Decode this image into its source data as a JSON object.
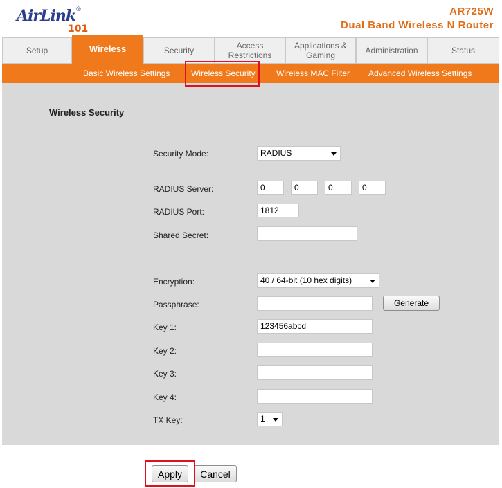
{
  "brand": {
    "logo_text": "AirLink",
    "logo_reg": "®",
    "logo_101": "101",
    "model": "AR725W",
    "product": "Dual Band Wireless N Router"
  },
  "tabs": [
    {
      "label": "Setup"
    },
    {
      "label": "Wireless"
    },
    {
      "label": "Security"
    },
    {
      "label_line1": "Access",
      "label_line2": "Restrictions"
    },
    {
      "label_line1": "Applications &",
      "label_line2": "Gaming"
    },
    {
      "label": "Administration"
    },
    {
      "label": "Status"
    }
  ],
  "subnav": [
    {
      "label": "Basic Wireless Settings"
    },
    {
      "label": "Wireless Security"
    },
    {
      "label": "Wireless MAC Filter"
    },
    {
      "label": "Advanced Wireless Settings"
    }
  ],
  "section": {
    "title": "Wireless Security"
  },
  "form": {
    "security_mode_label": "Security Mode:",
    "security_mode_value": "RADIUS",
    "radius_server_label": "RADIUS Server:",
    "radius_server_octets": [
      "0",
      "0",
      "0",
      "0"
    ],
    "ip_dot": ".",
    "radius_port_label": "RADIUS Port:",
    "radius_port_value": "1812",
    "shared_secret_label": "Shared Secret:",
    "shared_secret_value": "",
    "encryption_label": "Encryption:",
    "encryption_value": "40 / 64-bit (10 hex digits)",
    "passphrase_label": "Passphrase:",
    "passphrase_value": "",
    "generate_label": "Generate",
    "key1_label": "Key 1:",
    "key1_value": "123456abcd",
    "key2_label": "Key 2:",
    "key2_value": "",
    "key3_label": "Key 3:",
    "key3_value": "",
    "key4_label": "Key 4:",
    "key4_value": "",
    "txkey_label": "TX Key:",
    "txkey_value": "1"
  },
  "actions": {
    "apply_label": "Apply",
    "cancel_label": "Cancel"
  },
  "colors": {
    "accent": "#f07a1b",
    "highlight": "#e01020",
    "panel": "#d9d9d9",
    "logo": "#2a3d8c"
  }
}
